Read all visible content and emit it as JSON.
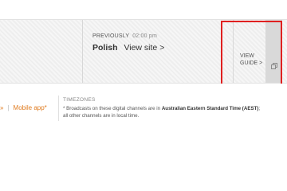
{
  "guide": {
    "previously_label": "PREVIOUSLY",
    "previously_time": "02:00 pm",
    "previously_channel": "Polish",
    "view_site_label": "View site",
    "view_site_chevron": ">",
    "view_guide_line1": "VIEW",
    "view_guide_line2": "GUIDE",
    "view_guide_chevron": ">",
    "pin_icon": "pin-icon"
  },
  "footer": {
    "apps_prefix": "»",
    "mobile_app_label": "Mobile app*",
    "timezones_title": "TIMEZONES",
    "timezone_text_before": "* Broadcasts on these digital channels are in ",
    "timezone_text_bold": "Australian Eastern Standard Time (AEST)",
    "timezone_text_after": ";",
    "timezone_text_line2": "all other channels are in local time."
  },
  "colors": {
    "accent": "#e07b1f",
    "highlight": "#e02020",
    "bar_bg": "#eeeeee",
    "tab_bg": "#d9d9d9"
  }
}
